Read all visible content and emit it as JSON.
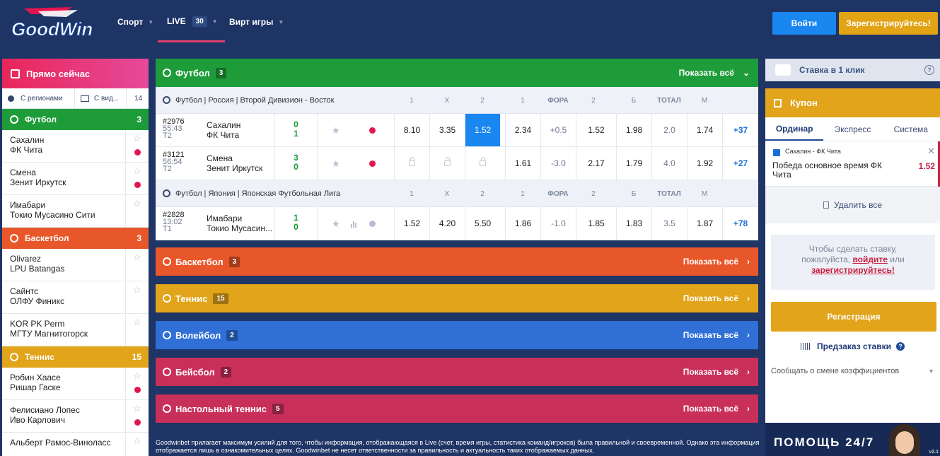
{
  "brand": {
    "name": "GoodWin"
  },
  "nav": {
    "sport": "Спорт",
    "live": "LIVE",
    "live_count": "30",
    "virtual": "Вирт игры",
    "login": "Войти",
    "register": "Зарегистрируйтесь!"
  },
  "leftbar": {
    "title": "Прямо сейчас",
    "filter_regions": "С регионами",
    "filter_view": "С вид...",
    "filter_count": "14",
    "sports": [
      {
        "name": "Футбол",
        "count": "3",
        "color": "#1f9c3a",
        "matches": [
          {
            "t1": "Сахалин",
            "t2": "ФК Чита"
          },
          {
            "t1": "Смена",
            "t2": "Зенит Иркутск"
          },
          {
            "t1": "Имабари",
            "t2": "Токио Мусасино Сити"
          }
        ]
      },
      {
        "name": "Баскетбол",
        "count": "3",
        "color": "#e8572a",
        "matches": [
          {
            "t1": "Olivarez",
            "t2": "LPU Batangas"
          },
          {
            "t1": "Сайнтс",
            "t2": "ОЛФУ Финикс"
          },
          {
            "t1": "KOR PK Perm",
            "t2": "МГТУ Магнитогорск"
          }
        ]
      },
      {
        "name": "Теннис",
        "count": "15",
        "color": "#e1a41a",
        "matches": [
          {
            "t1": "Робин Хаасе",
            "t2": "Ришар Гаске"
          },
          {
            "t1": "Фелисиано Лопес",
            "t2": "Иво Карлович"
          },
          {
            "t1": "Альберт Рамос-Виноласс",
            "t2": ""
          }
        ]
      }
    ]
  },
  "main": {
    "show_all": "Показать всё",
    "football": {
      "name": "Футбол",
      "count": "3",
      "leagues": [
        {
          "name": "Футбол | Россия | Второй Дивизион - Восток",
          "cols": [
            "1",
            "X",
            "2",
            "1",
            "ФОРА",
            "2",
            "Б",
            "ТОТАЛ",
            "М"
          ],
          "events": [
            {
              "id": "#2976",
              "time": "55:43",
              "half": "T2",
              "t1": "Сахалин",
              "t2": "ФК Чита",
              "s1": "0",
              "s2": "1",
              "odds": [
                "8.10",
                "3.35",
                "1.52",
                "2.34",
                "+0.5",
                "1.52",
                "1.98",
                "2.0",
                "1.74"
              ],
              "more": "+37"
            },
            {
              "id": "#3121",
              "time": "56:54",
              "half": "T2",
              "t1": "Смена",
              "t2": "Зенит Иркутск",
              "s1": "3",
              "s2": "0",
              "odds": [
                "",
                "",
                "",
                "1.61",
                "-3.0",
                "2.17",
                "1.79",
                "4.0",
                "1.92"
              ],
              "more": "+27"
            }
          ]
        },
        {
          "name": "Футбол | Япония | Японская Футбольная Лига",
          "cols": [
            "1",
            "X",
            "2",
            "1",
            "ФОРА",
            "2",
            "Б",
            "ТОТАЛ",
            "М"
          ],
          "events": [
            {
              "id": "#2828",
              "time": "13:02",
              "half": "T1",
              "t1": "Имабари",
              "t2": "Токио Мусасин...",
              "s1": "1",
              "s2": "0",
              "odds": [
                "1.52",
                "4.20",
                "5.50",
                "1.86",
                "-1.0",
                "1.85",
                "1.83",
                "3.5",
                "1.87"
              ],
              "more": "+78"
            }
          ]
        }
      ]
    },
    "others": [
      {
        "name": "Баскетбол",
        "count": "3",
        "color": "#e8572a"
      },
      {
        "name": "Теннис",
        "count": "15",
        "color": "#e1a41a"
      },
      {
        "name": "Волейбол",
        "count": "2",
        "color": "#2f6fd6"
      },
      {
        "name": "Бейсбол",
        "count": "2",
        "color": "#c8305a"
      },
      {
        "name": "Настольный теннис",
        "count": "5",
        "color": "#c8305a"
      }
    ],
    "disclaimer": "Goodwinbet прилагает максимум усилий для того, чтобы информация, отображающаяся в Live (счет, время игры, статистика команд/игроков) была правильной и своевременной. Однако эта информация отображается лишь в ознакомительных целях. Goodwinbet не несет ответственности за правильность и актуальность таких отображаемых данных."
  },
  "right": {
    "oneclick": "Ставка в 1 клик",
    "coupon_title": "Купон",
    "tabs": [
      "Ординар",
      "Экспресс",
      "Система"
    ],
    "bet_event": "Сахалин - ФК Чита",
    "bet_desc": "Победа основное время ФК Чита",
    "bet_value": "1.52",
    "delete_all": "Удалить все",
    "msg_1": "Чтобы сделать ставку,",
    "msg_2": "пожалуйста,",
    "msg_login": "войдите",
    "msg_or": "или",
    "msg_register": "зарегистрируйтесь!",
    "reg_button": "Регистрация",
    "preorder": "Предзаказ ставки",
    "notify": "Сообщать о смене коэффициентов",
    "help": "ПОМОЩЬ 24/7",
    "version": "v2.1"
  }
}
